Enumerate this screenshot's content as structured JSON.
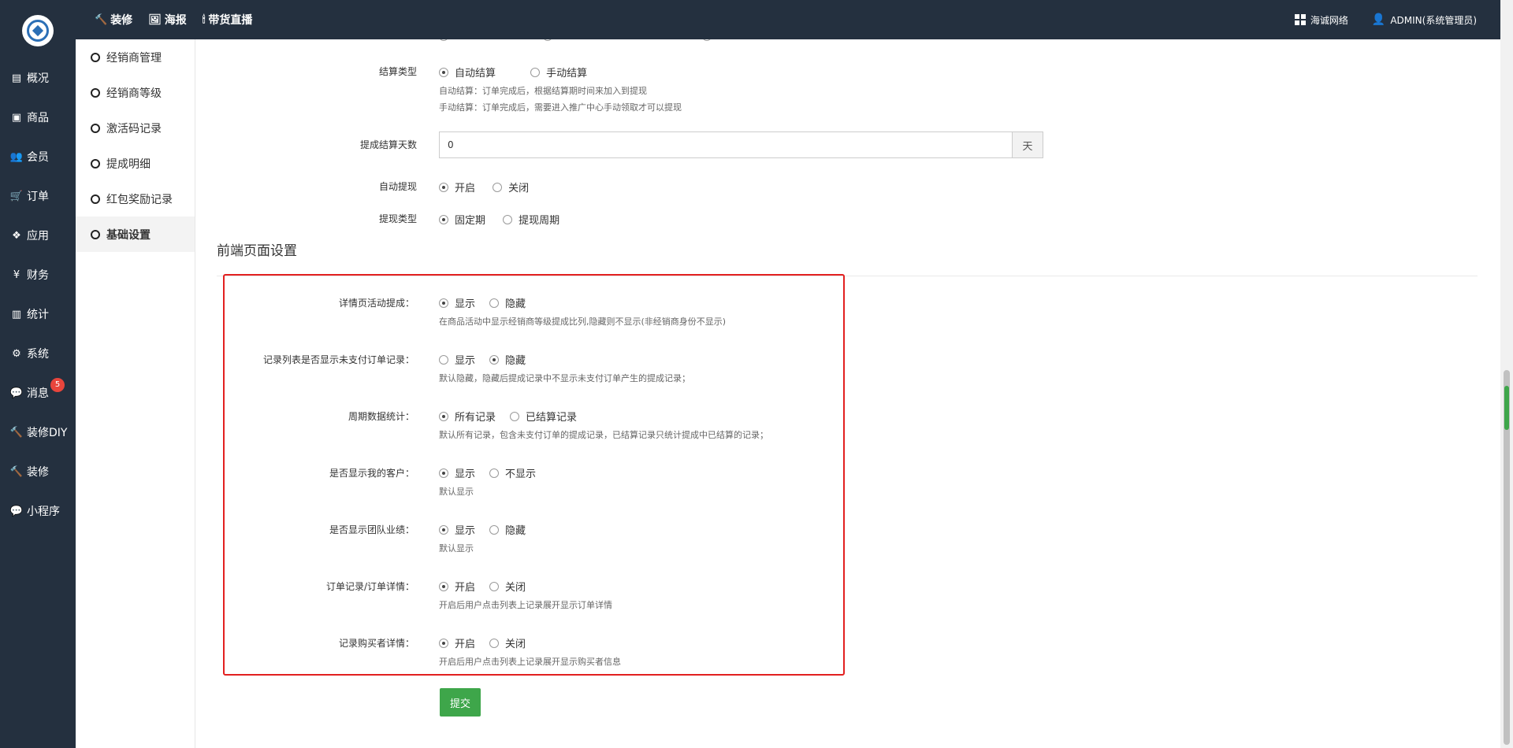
{
  "topnav": [
    {
      "icon": "hammer-icon",
      "glyph": "🔨",
      "label": "装修"
    },
    {
      "icon": "image-icon",
      "glyph": "🖼",
      "label": "海报"
    },
    {
      "icon": "torch-icon",
      "glyph": "🕯",
      "label": "带货直播"
    }
  ],
  "topright": {
    "company": "海诚网络",
    "user": "ADMIN(系统管理员)"
  },
  "leftnav": [
    {
      "name": "overview",
      "icon": "monitor-icon",
      "glyph": "▤",
      "label": "概况"
    },
    {
      "name": "goods",
      "icon": "box-icon",
      "glyph": "▣",
      "label": "商品"
    },
    {
      "name": "members",
      "icon": "users-icon",
      "glyph": "👥",
      "label": "会员"
    },
    {
      "name": "orders",
      "icon": "cart-icon",
      "glyph": "🛒",
      "label": "订单"
    },
    {
      "name": "apps",
      "icon": "cubes-icon",
      "glyph": "❖",
      "label": "应用"
    },
    {
      "name": "finance",
      "icon": "yen-icon",
      "glyph": "¥",
      "label": "财务"
    },
    {
      "name": "stats",
      "icon": "bar-chart-icon",
      "glyph": "▥",
      "label": "统计"
    },
    {
      "name": "system",
      "icon": "gears-icon",
      "glyph": "⚙",
      "label": "系统"
    },
    {
      "name": "messages",
      "icon": "chat-icon",
      "glyph": "💬",
      "label": "消息",
      "badge": "5"
    },
    {
      "name": "diy",
      "icon": "hammer-icon",
      "glyph": "🔨",
      "label": "装修DIY"
    },
    {
      "name": "decorate",
      "icon": "hammer-icon",
      "glyph": "🔨",
      "label": "装修"
    },
    {
      "name": "miniprogram",
      "icon": "wechat-icon",
      "glyph": "💬",
      "label": "小程序"
    }
  ],
  "subnav": [
    {
      "label": "经销商管理",
      "active": false
    },
    {
      "label": "经销商等级",
      "active": false
    },
    {
      "label": "激活码记录",
      "active": false
    },
    {
      "label": "提成明细",
      "active": false
    },
    {
      "label": "红包奖励记录",
      "active": false
    },
    {
      "label": "基础设置",
      "active": true
    }
  ],
  "top_form": {
    "settlement_type": {
      "label": "结算类型",
      "options": [
        "自动结算",
        "手动结算"
      ],
      "selected": 0,
      "help1": "自动结算：订单完成后，根据结算期时间来加入到提现",
      "help2": "手动结算：订单完成后，需要进入推广中心手动领取才可以提现"
    },
    "settle_days": {
      "label": "提成结算天数",
      "value": "0",
      "unit": "天"
    },
    "auto_withdraw": {
      "label": "自动提现",
      "options": [
        "开启",
        "关闭"
      ],
      "selected": 0
    },
    "withdraw_type": {
      "label": "提现类型",
      "options": [
        "固定期",
        "提现周期"
      ],
      "selected": 0
    }
  },
  "section_title": "前端页面设置",
  "frontend_settings": [
    {
      "name": "detail-commission",
      "label": "详情页活动提成：",
      "options": [
        "显示",
        "隐藏"
      ],
      "selected": 0,
      "help": "在商品活动中显示经销商等级提成比列,隐藏则不显示(非经销商身份不显示)"
    },
    {
      "name": "unpaid-records",
      "label": "记录列表是否显示未支付订单记录：",
      "options": [
        "显示",
        "隐藏"
      ],
      "selected": 1,
      "help": "默认隐藏，隐藏后提成记录中不显示未支付订单产生的提成记录；"
    },
    {
      "name": "period-stats",
      "label": "周期数据统计：",
      "options": [
        "所有记录",
        "已结算记录"
      ],
      "selected": 0,
      "help": "默认所有记录，包含未支付订单的提成记录，已结算记录只统计提成中已结算的记录；"
    },
    {
      "name": "show-customers",
      "label": "是否显示我的客户：",
      "options": [
        "显示",
        "不显示"
      ],
      "selected": 0,
      "help": "默认显示"
    },
    {
      "name": "team-performance",
      "label": "是否显示团队业绩：",
      "options": [
        "显示",
        "隐藏"
      ],
      "selected": 0,
      "help": "默认显示"
    },
    {
      "name": "order-detail",
      "label": "订单记录/订单详情：",
      "options": [
        "开启",
        "关闭"
      ],
      "selected": 0,
      "help": "开启后用户点击列表上记录展开显示订单详情"
    },
    {
      "name": "buyer-detail",
      "label": "记录购买者详情：",
      "options": [
        "开启",
        "关闭"
      ],
      "selected": 0,
      "help": "开启后用户点击列表上记录展开显示购买者信息"
    }
  ],
  "submit_label": "提交",
  "colors": {
    "sidebar": "#24303f",
    "highlight": "#e22020",
    "submit": "#3ea64a",
    "badge": "#e8453c"
  }
}
